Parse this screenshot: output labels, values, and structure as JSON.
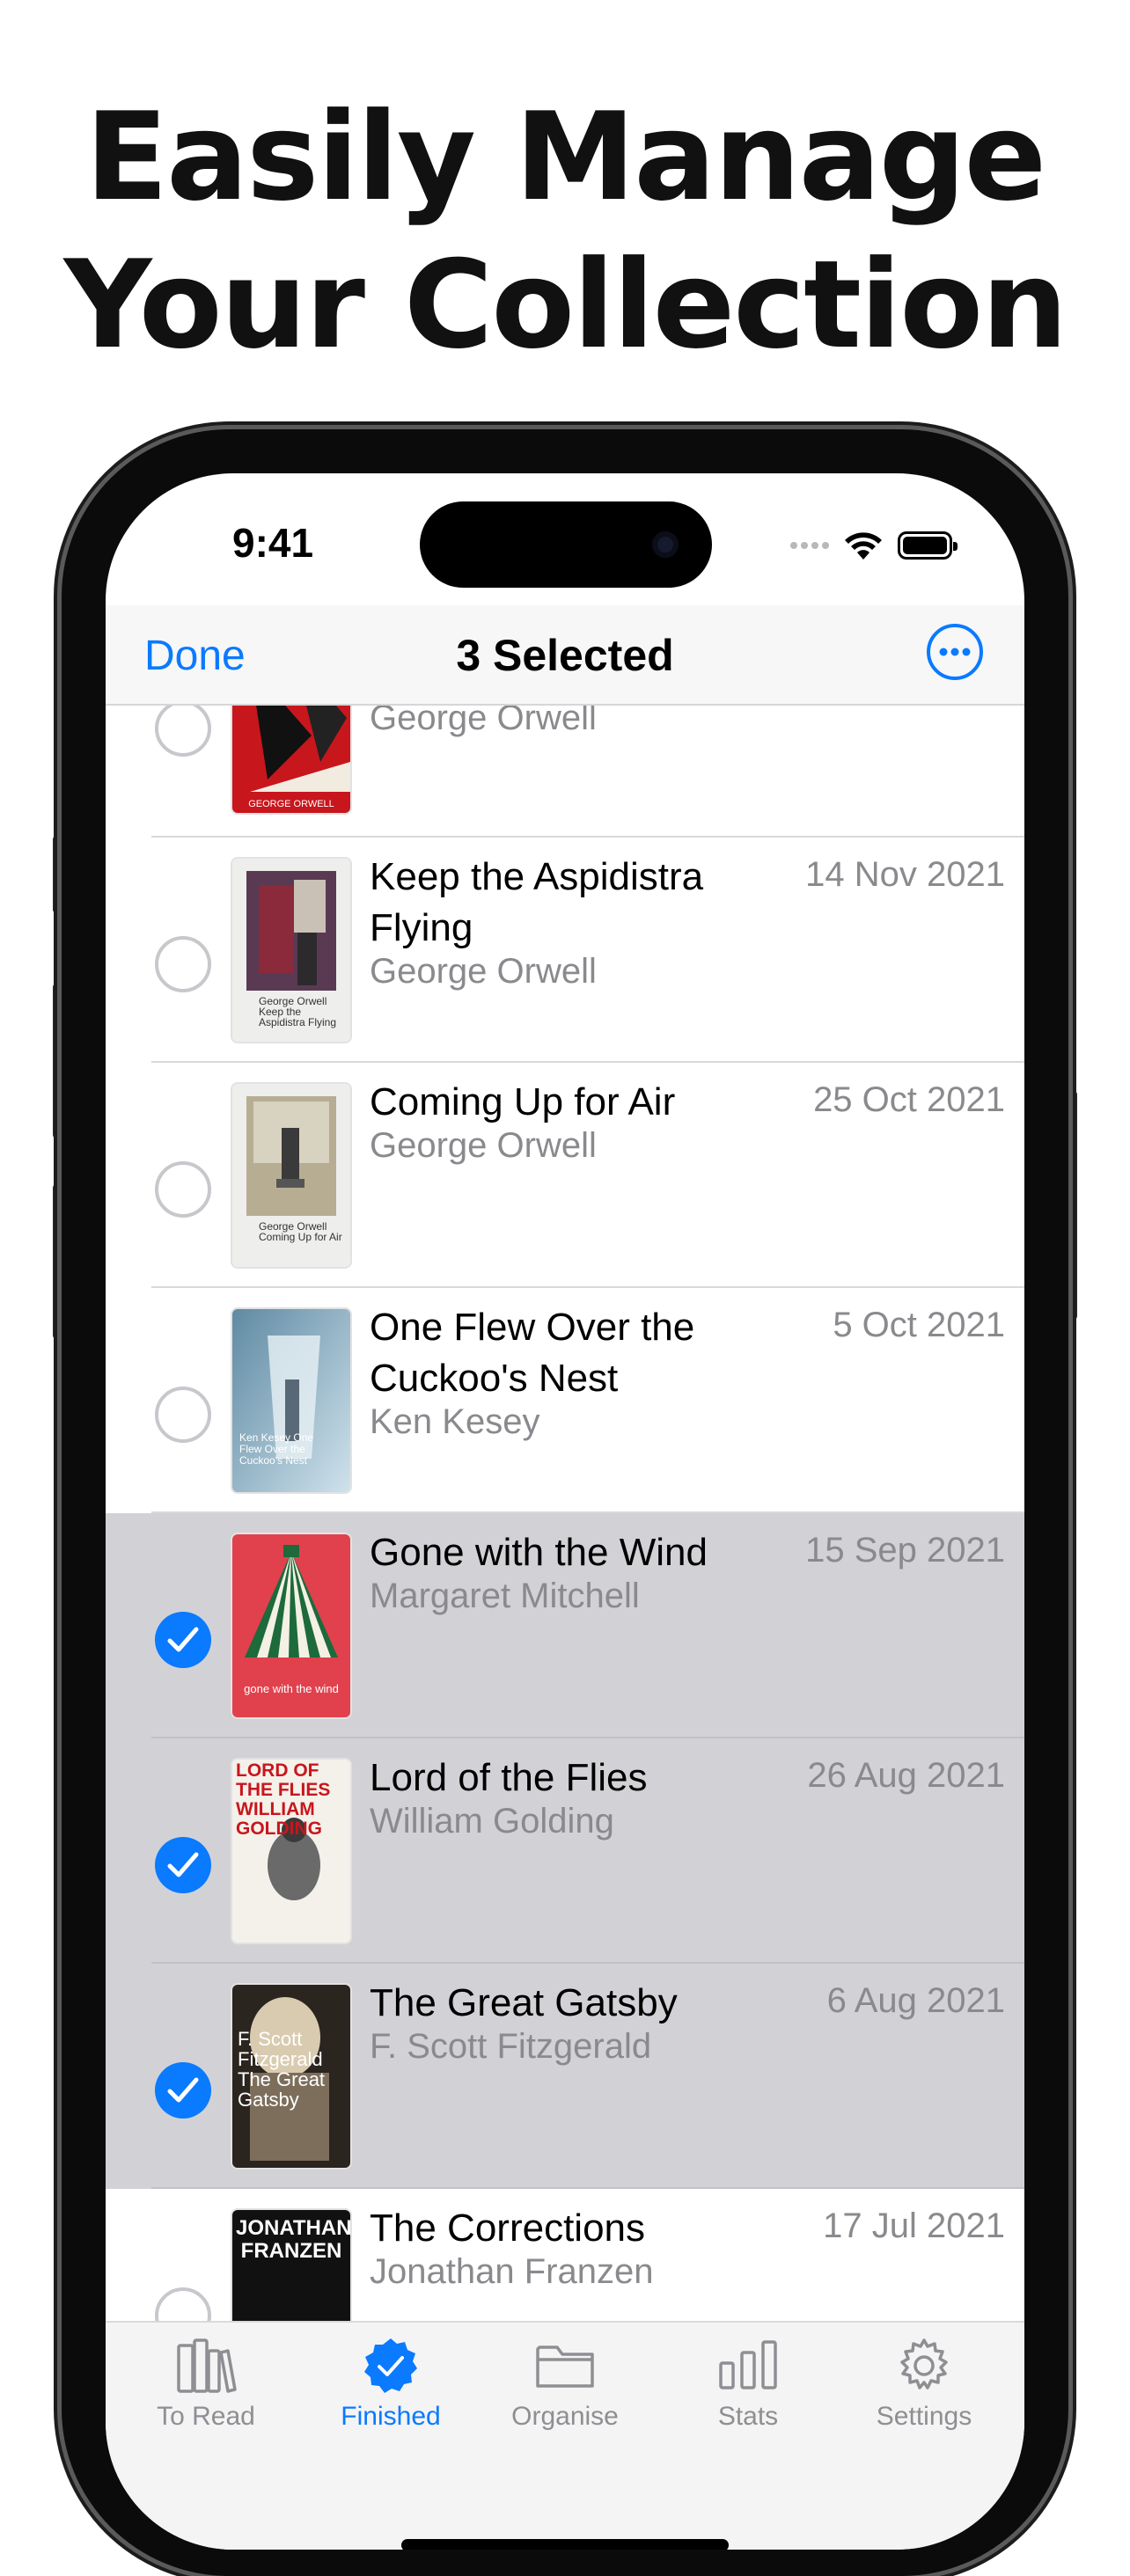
{
  "headline": {
    "line1": "Easily Manage",
    "line2": "Your Collection"
  },
  "status_bar": {
    "time": "9:41",
    "icons": [
      "signal-dots-icon",
      "wifi-icon",
      "battery-icon"
    ]
  },
  "nav": {
    "done_label": "Done",
    "title": "3 Selected",
    "more_icon": "ellipsis-circle-icon"
  },
  "books": [
    {
      "title": "",
      "author": "George Orwell",
      "date": "",
      "selected": false,
      "cover_text": "GEORGE ORWELL"
    },
    {
      "title": "Keep the Aspidistra Flying",
      "author": "George Orwell",
      "date": "14 Nov 2021",
      "selected": false,
      "cover_text": "George Orwell Keep the Aspidistra Flying"
    },
    {
      "title": "Coming Up for Air",
      "author": "George Orwell",
      "date": "25 Oct 2021",
      "selected": false,
      "cover_text": "George Orwell Coming Up for Air"
    },
    {
      "title": "One Flew Over the Cuckoo's Nest",
      "author": "Ken Kesey",
      "date": "5 Oct 2021",
      "selected": false,
      "cover_text": "Ken Kesey One Flew Over the Cuckoo's Nest"
    },
    {
      "title": "Gone with the Wind",
      "author": "Margaret Mitchell",
      "date": "15 Sep 2021",
      "selected": true,
      "cover_text": "gone with the wind"
    },
    {
      "title": "Lord of the Flies",
      "author": "William Golding",
      "date": "26 Aug 2021",
      "selected": true,
      "cover_text": "LORD OF THE FLIES WILLIAM GOLDING"
    },
    {
      "title": "The Great Gatsby",
      "author": "F. Scott Fitzgerald",
      "date": "6 Aug 2021",
      "selected": true,
      "cover_text": "F. Scott Fitzgerald The Great Gatsby"
    },
    {
      "title": "The Corrections",
      "author": "Jonathan Franzen",
      "date": "17 Jul 2021",
      "selected": false,
      "cover_text": "JONATHAN FRANZEN"
    }
  ],
  "tabs": [
    {
      "label": "To Read",
      "icon": "books-icon",
      "active": false
    },
    {
      "label": "Finished",
      "icon": "checkmark-seal-icon",
      "active": true
    },
    {
      "label": "Organise",
      "icon": "folder-icon",
      "active": false
    },
    {
      "label": "Stats",
      "icon": "bar-chart-icon",
      "active": false
    },
    {
      "label": "Settings",
      "icon": "gear-icon",
      "active": false
    }
  ],
  "colors": {
    "accent": "#0a7aff",
    "selected_row": "#d2d2d6",
    "secondary_text": "#8a8a8e"
  }
}
